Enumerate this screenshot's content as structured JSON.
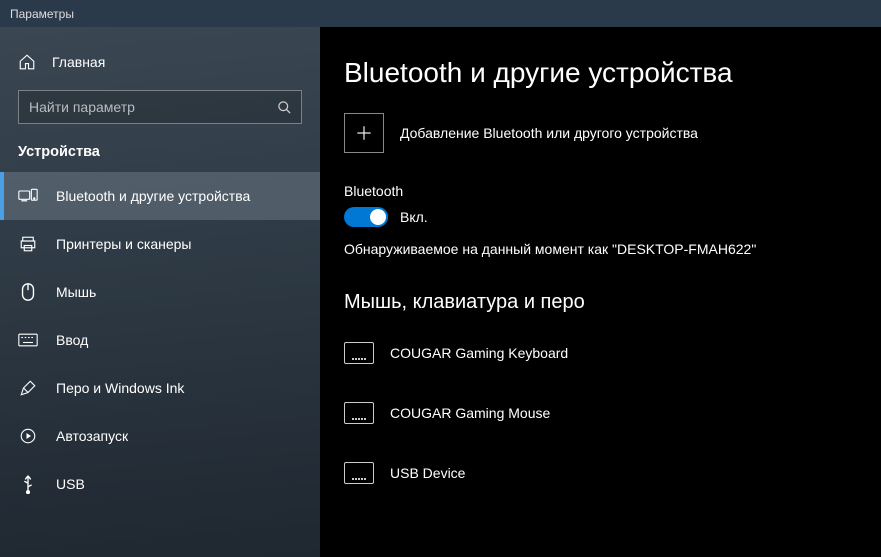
{
  "window": {
    "title": "Параметры"
  },
  "sidebar": {
    "home": "Главная",
    "search_placeholder": "Найти параметр",
    "section": "Устройства",
    "items": [
      {
        "label": "Bluetooth и другие устройства"
      },
      {
        "label": "Принтеры и сканеры"
      },
      {
        "label": "Мышь"
      },
      {
        "label": "Ввод"
      },
      {
        "label": "Перо и Windows Ink"
      },
      {
        "label": "Автозапуск"
      },
      {
        "label": "USB"
      }
    ]
  },
  "main": {
    "title": "Bluetooth и другие устройства",
    "add_device": "Добавление Bluetooth или другого устройства",
    "bluetooth_label": "Bluetooth",
    "toggle_state": "Вкл.",
    "discoverable": "Обнаруживаемое на данный момент как \"DESKTOP-FMAH622\"",
    "category": "Мышь, клавиатура и перо",
    "devices": [
      {
        "name": "COUGAR Gaming Keyboard"
      },
      {
        "name": "COUGAR Gaming Mouse"
      },
      {
        "name": "USB Device"
      }
    ]
  }
}
